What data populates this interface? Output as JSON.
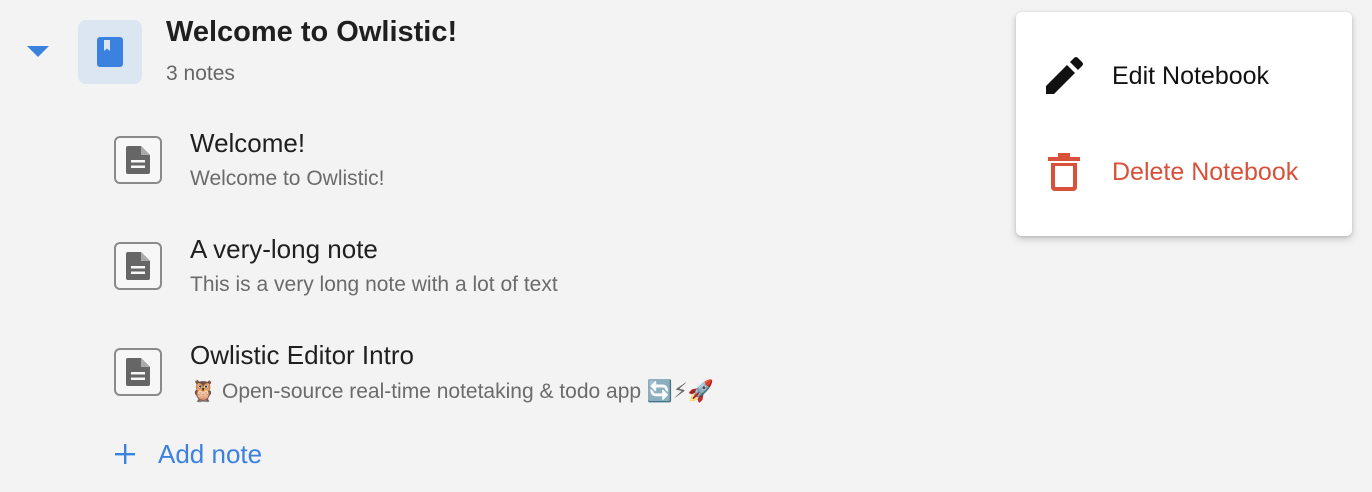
{
  "notebook": {
    "title": "Welcome to Owlistic!",
    "count_text": "3 notes",
    "icon": "book-icon",
    "expanded": true
  },
  "notes": [
    {
      "title": "Welcome!",
      "subtitle": "Welcome to Owlistic!",
      "icon": "document-icon"
    },
    {
      "title": "A very-long note",
      "subtitle": "This is a very long note with a lot of text",
      "icon": "document-icon"
    },
    {
      "title": "Owlistic Editor Intro",
      "subtitle": "🦉 Open-source real-time notetaking & todo app 🔄⚡🚀",
      "icon": "document-icon"
    }
  ],
  "add_note": {
    "label": "Add note",
    "icon": "plus-icon"
  },
  "context_menu": {
    "items": [
      {
        "label": "Edit Notebook",
        "icon": "pencil-icon"
      },
      {
        "label": "Delete Notebook",
        "icon": "trash-icon"
      }
    ]
  },
  "colors": {
    "accent": "#3b82e0",
    "danger": "#d9513a",
    "background": "#f3f3f3"
  }
}
